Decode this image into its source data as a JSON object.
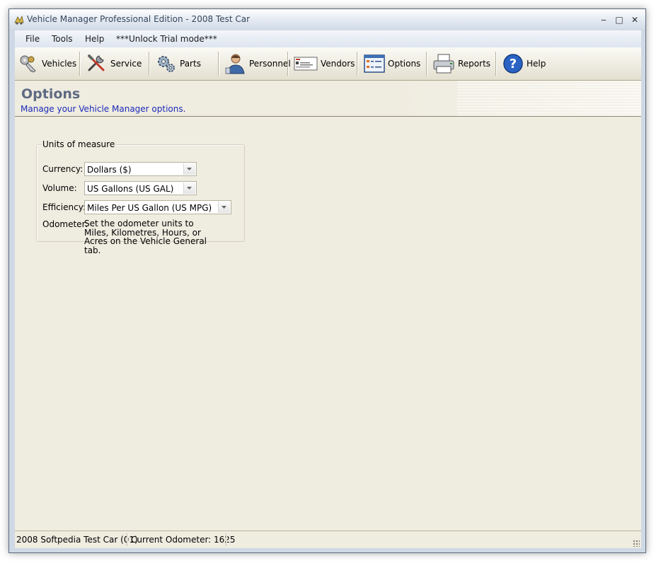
{
  "window": {
    "title": "Vehicle Manager Professional Edition - 2008 Test Car",
    "controls": {
      "minimize": "‒",
      "maximize": "□",
      "close": "✕"
    }
  },
  "menu": {
    "items": [
      {
        "label": "File"
      },
      {
        "label": "Tools"
      },
      {
        "label": "Help"
      },
      {
        "label": "***Unlock Trial mode***"
      }
    ]
  },
  "toolbar": {
    "buttons": [
      {
        "label": "Vehicles",
        "icon": "keys-icon"
      },
      {
        "label": "Service",
        "icon": "tools-icon"
      },
      {
        "label": "Parts",
        "icon": "gears-icon"
      },
      {
        "label": "Personnel",
        "icon": "person-icon"
      },
      {
        "label": "Vendors",
        "icon": "business-card-icon"
      },
      {
        "label": "Options",
        "icon": "options-list-icon"
      },
      {
        "label": "Reports",
        "icon": "printer-icon"
      },
      {
        "label": "Help",
        "icon": "help-icon"
      }
    ]
  },
  "page": {
    "title": "Options",
    "subtitle": "Manage your Vehicle Manager options."
  },
  "units": {
    "legend": "Units of measure",
    "currency_label": "Currency:",
    "currency_value": "Dollars ($)",
    "volume_label": "Volume:",
    "volume_value": "US Gallons (US GAL)",
    "efficiency_label": "Efficiency:",
    "efficiency_value": "Miles Per US Gallon (US MPG)",
    "odometer_label": "Odometer:",
    "odometer_text": "Set the odometer units to Miles, Kilometres, Hours, or Acres on the Vehicle General tab."
  },
  "status": {
    "vehicle": "2008 Softpedia Test Car (01)",
    "odometer": "Current Odometer: 1625"
  },
  "colors": {
    "accent_title": "#5e6a82",
    "subtitle_blue": "#1a2ab8",
    "background": "#efece0"
  }
}
